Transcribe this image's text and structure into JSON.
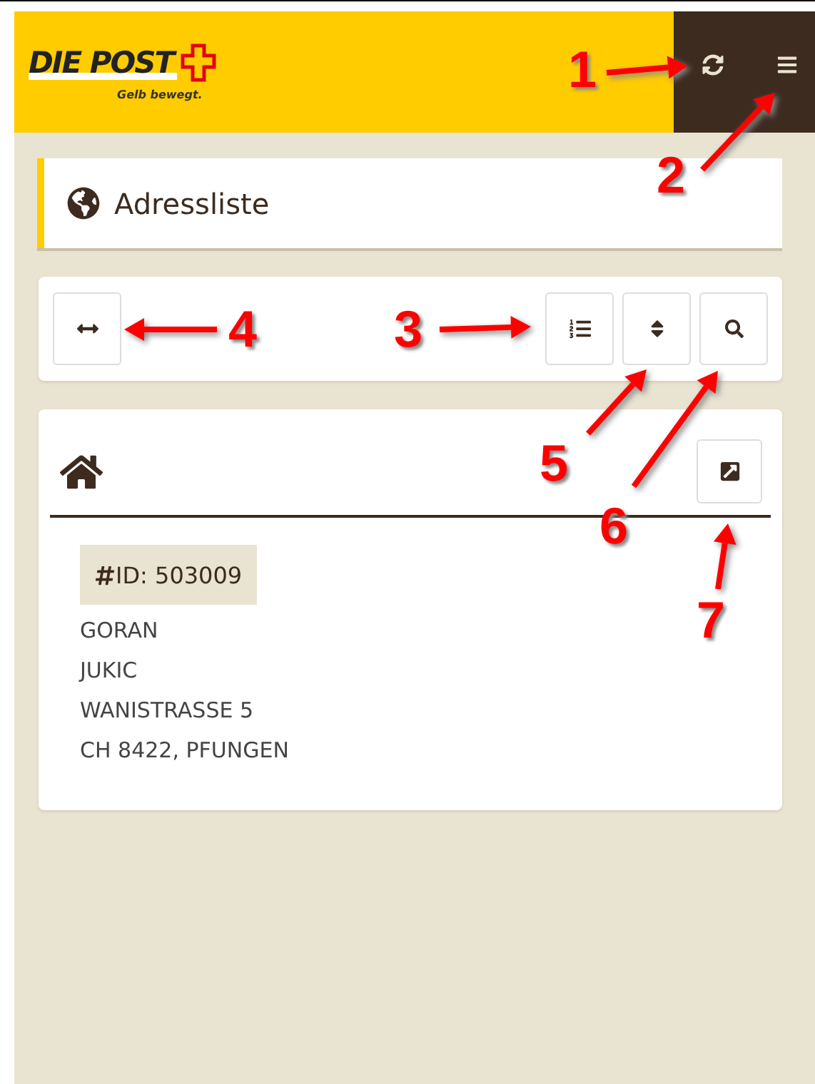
{
  "header": {
    "logo": {
      "name": "DIE POST",
      "slogan": "Gelb bewegt."
    }
  },
  "page_title": "Adressliste",
  "address": {
    "id_label": "ID: 503009",
    "lines": [
      "GORAN",
      "JUKIC",
      "WANISTRASSE 5",
      "CH 8422, PFUNGEN"
    ]
  },
  "annotations": [
    {
      "label": "1"
    },
    {
      "label": "2"
    },
    {
      "label": "3"
    },
    {
      "label": "4"
    },
    {
      "label": "5"
    },
    {
      "label": "6"
    },
    {
      "label": "7"
    }
  ]
}
